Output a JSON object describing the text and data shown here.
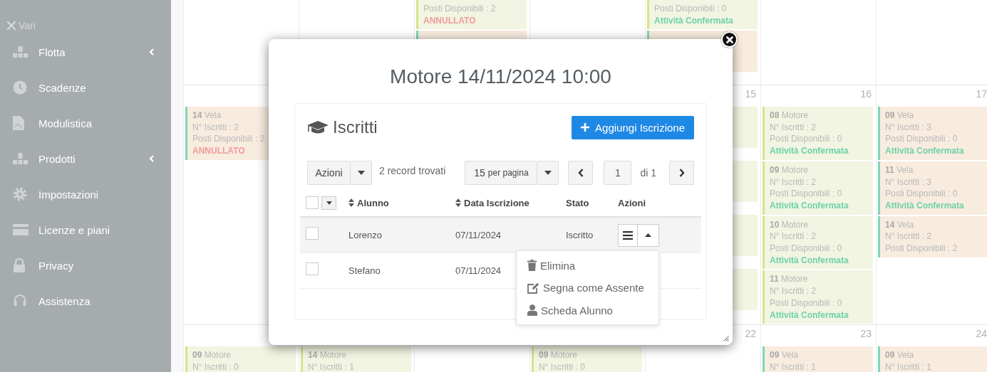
{
  "sidebar": {
    "section": "Vari",
    "items": [
      {
        "label": "Flotta",
        "has_submenu": true
      },
      {
        "label": "Scadenze",
        "has_submenu": false
      },
      {
        "label": "Modulistica",
        "has_submenu": false
      },
      {
        "label": "Prodotti",
        "has_submenu": true
      },
      {
        "label": "Impostazioni",
        "has_submenu": false
      },
      {
        "label": "Licenze e piani",
        "has_submenu": false
      },
      {
        "label": "Privacy",
        "has_submenu": false
      },
      {
        "label": "Assistenza",
        "has_submenu": false
      }
    ]
  },
  "calendar": {
    "weeks": [
      {
        "cells": [
          {},
          {},
          {
            "events": [
              {
                "kind": "motore",
                "lines": [
                  "Posti Disponibili : 2"
                ],
                "status": {
                  "kind": "cancelled",
                  "text": "ANNULLATO"
                }
              },
              {
                "kind": "vela"
              }
            ]
          },
          {},
          {
            "events": [
              {
                "kind": "motore",
                "lines": [
                  "Posti Disponibili : 0"
                ],
                "status": {
                  "kind": "confirmed",
                  "text": "Attività Confermata"
                }
              },
              {
                "kind": "vela"
              }
            ]
          },
          {},
          {}
        ]
      },
      {
        "cells": [
          {
            "events": [
              {
                "kind": "vela",
                "title": "**14** Vela",
                "lines": [
                  "N° Iscritti : 2",
                  "Posti Disponibili : 2"
                ],
                "status": {
                  "kind": "cancelled",
                  "text": "ANNULLATO"
                }
              }
            ]
          },
          {},
          {},
          {},
          {
            "day": "15",
            "events": [
              {
                "kind": "motore"
              },
              {
                "kind": "motore"
              },
              {
                "kind": "motore"
              },
              {
                "kind": "motore"
              }
            ]
          },
          {
            "day": "16",
            "events": [
              {
                "kind": "motore",
                "title": "**08** Motore",
                "lines": [
                  "N° Iscritti : 2",
                  "Posti Disponibili : 0"
                ],
                "status": {
                  "kind": "confirmed",
                  "text": "Attività Confermata"
                }
              },
              {
                "kind": "motore",
                "title": "**09** Motore",
                "lines": [
                  "N° Iscritti : 2",
                  "Posti Disponibili : 0"
                ],
                "status": {
                  "kind": "confirmed",
                  "text": "Attività Confermata"
                }
              },
              {
                "kind": "motore",
                "title": "**10** Motore",
                "lines": [
                  "N° Iscritti : 2",
                  "Posti Disponibili : 0"
                ],
                "status": {
                  "kind": "confirmed",
                  "text": "Attività Confermata"
                }
              },
              {
                "kind": "motore",
                "title": "**11** Motore",
                "lines": [
                  "N° Iscritti : 2",
                  "Posti Disponibili : 0"
                ],
                "status": {
                  "kind": "confirmed",
                  "text": "Attività Confermata"
                }
              }
            ]
          },
          {
            "day": "17",
            "events": [
              {
                "kind": "vela",
                "title": "**09** Vela",
                "lines": [
                  "N° Iscritti : 3",
                  "Posti Disponibili : 0"
                ],
                "status": {
                  "kind": "confirmed",
                  "text": "Attività Confermata"
                }
              },
              {
                "kind": "vela",
                "title": "**11** Vela",
                "lines": [
                  "N° Iscritti : 3",
                  "Posti Disponibili : 0"
                ],
                "status": {
                  "kind": "confirmed",
                  "text": "Attività Confermata"
                }
              },
              {
                "kind": "vela",
                "title": "**14** Vela",
                "lines": [
                  "N° Iscritti : 2",
                  "Posti Disponibili : 2"
                ]
              }
            ]
          }
        ]
      },
      {
        "cells": [
          {
            "events": [
              {
                "kind": "motore",
                "title": "**09** Motore",
                "lines": [
                  "N° Iscritti : 0"
                ]
              }
            ]
          },
          {
            "events": [
              {
                "kind": "motore",
                "title": "**14** Motore",
                "lines": [
                  "N° Iscritti : 1"
                ]
              }
            ]
          },
          {},
          {
            "events": [
              {
                "kind": "motore",
                "title": "**09** Motore",
                "lines": [
                  "N° Iscritti : 0"
                ]
              }
            ]
          },
          {
            "day": "22"
          },
          {
            "day": "23",
            "events": [
              {
                "kind": "vela",
                "title": "**09** Vela",
                "lines": [
                  "N° Iscritti : 1"
                ]
              }
            ]
          },
          {
            "day": "24",
            "events": [
              {
                "kind": "vela",
                "title": "**09** Vela",
                "lines": [
                  "N° Iscritti : 1"
                ]
              }
            ]
          }
        ]
      }
    ]
  },
  "modal": {
    "title": "Motore 14/11/2024 10:00",
    "panel": {
      "title": "Iscritti",
      "add_button": "Aggiungi Iscrizione",
      "bulk_button": "Azioni",
      "record_count": "2 record trovati",
      "page_size": {
        "count": "15",
        "unit": "per pagina"
      },
      "page": "1",
      "page_total": "di 1",
      "table": {
        "select_all_checked": false,
        "columns": [
          {
            "label": "Alunno",
            "sortable": true
          },
          {
            "label": "Data Iscrizione",
            "sortable": true
          },
          {
            "label": "Stato",
            "sortable": false
          },
          {
            "label": "Azioni",
            "sortable": false
          }
        ],
        "rows": [
          {
            "checked": false,
            "highlighted": true,
            "name": "Lorenzo",
            "date": "07/11/2024",
            "status": "Iscritto",
            "menu_open": true
          },
          {
            "checked": false,
            "highlighted": false,
            "name": "Stefano",
            "date": "07/11/2024"
          }
        ]
      },
      "row_menu": [
        "Elimina",
        "Segna come Assente",
        "Scheda Alunno"
      ]
    }
  }
}
